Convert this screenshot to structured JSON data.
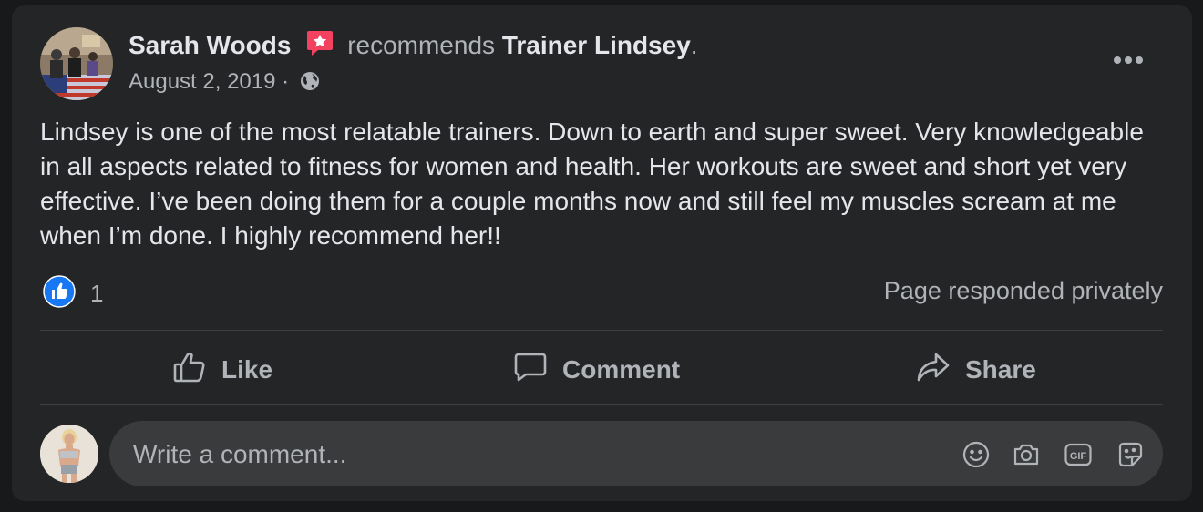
{
  "post": {
    "author": "Sarah Woods",
    "action_text": "recommends",
    "page_name": "Trainer Lindsey",
    "trailing_punct": ".",
    "date": "August 2, 2019",
    "date_separator": "·",
    "privacy_icon": "globe-icon",
    "body": "Lindsey is one of the most relatable trainers. Down to earth and super sweet. Very knowledgeable in all aspects related to fitness for women and health. Her workouts are sweet and short yet very effective. I’ve been doing them for a couple months now and still feel my muscles scream at me when I’m done. I highly recommend her!!"
  },
  "reactions": {
    "icon": "like-reaction-icon",
    "count": "1",
    "response_note": "Page responded privately"
  },
  "actions": {
    "like": "Like",
    "comment": "Comment",
    "share": "Share"
  },
  "comment_box": {
    "placeholder": "Write a comment...",
    "icons": [
      "emoji-icon",
      "camera-icon",
      "gif-icon",
      "sticker-icon"
    ]
  },
  "colors": {
    "card_bg": "#242526",
    "page_bg": "#18191a",
    "primary_text": "#e4e6eb",
    "secondary_text": "#b0b3b8",
    "like_blue": "#1877f2",
    "recommend_badge": "#f3425f"
  }
}
